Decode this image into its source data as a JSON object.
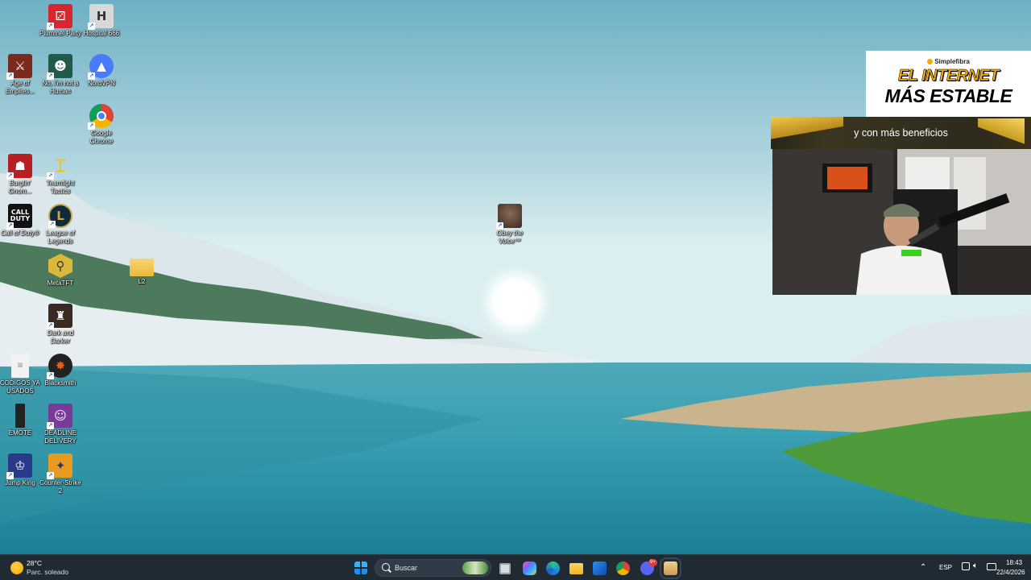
{
  "desktop": {
    "icons": [
      {
        "label": "Plummel Party",
        "icon": "plummel-party-icon",
        "color": "#d8262e"
      },
      {
        "label": "Hospital 666",
        "icon": "hospital-666-icon",
        "color": "#e8e8e8"
      },
      {
        "label": "Age of Empires...",
        "icon": "age-of-empires-icon",
        "color": "#7a2b1e"
      },
      {
        "label": "No, I'm not a Human",
        "icon": "no-im-not-a-human-icon",
        "color": "#1f5a4a"
      },
      {
        "label": "NordVPN",
        "icon": "nordvpn-icon",
        "color": "#4a7bff"
      },
      {
        "label": "Google Chrome",
        "icon": "google-chrome-icon",
        "color": "#db4437"
      },
      {
        "label": "Burglin' Gnom...",
        "icon": "burglin-gnomes-icon",
        "color": "#b81f22"
      },
      {
        "label": "Teamfight Tactics",
        "icon": "teamfight-tactics-icon",
        "color": "#f0c020"
      },
      {
        "label": "Call of Duty®",
        "icon": "call-of-duty-icon",
        "color": "#111111"
      },
      {
        "label": "League of Legends",
        "icon": "league-of-legends-icon",
        "color": "#0f2a3a"
      },
      {
        "label": "MetaTFT",
        "icon": "metatft-icon",
        "color": "#d9b83a"
      },
      {
        "label": "L2",
        "icon": "folder-icon",
        "color": "#f3c84a"
      },
      {
        "label": "Dark and Darker",
        "icon": "dark-and-darker-icon",
        "color": "#3a2a22"
      },
      {
        "label": "CODIGOS YA USADOS",
        "icon": "text-document-icon",
        "color": "#f2f2f2"
      },
      {
        "label": "Blacksmith",
        "icon": "blacksmith-icon",
        "color": "#e8601c"
      },
      {
        "label": "EMOTE",
        "icon": "emote-file-icon",
        "color": "#222222"
      },
      {
        "label": "DEADLINE DELIVERY",
        "icon": "deadline-delivery-icon",
        "color": "#7a3a9a"
      },
      {
        "label": "Jump King",
        "icon": "jump-king-icon",
        "color": "#2a3a8a"
      },
      {
        "label": "Counter-Strike 2",
        "icon": "counter-strike-2-icon",
        "color": "#e89a20"
      },
      {
        "label": "Obey the Voice™",
        "icon": "obey-the-voice-icon",
        "color": "#6a4a3a"
      }
    ]
  },
  "ad": {
    "brand": "Simplefibra",
    "line1": "EL INTERNET",
    "line2": "MÁS ESTABLE",
    "banner": "y con más beneficios",
    "accent": "#f5a800"
  },
  "taskbar": {
    "weather_temp": "28°C",
    "weather_desc": "Parc. soleado",
    "search_placeholder": "Buscar",
    "language": "ESP",
    "time": "18:43",
    "date": "22/4/2026",
    "discord_badge": "9+",
    "apps": [
      "start-icon",
      "task-view-icon",
      "copilot-icon",
      "edge-icon",
      "file-explorer-icon",
      "outlook-icon",
      "chrome-icon",
      "discord-icon",
      "game-app-icon"
    ]
  }
}
